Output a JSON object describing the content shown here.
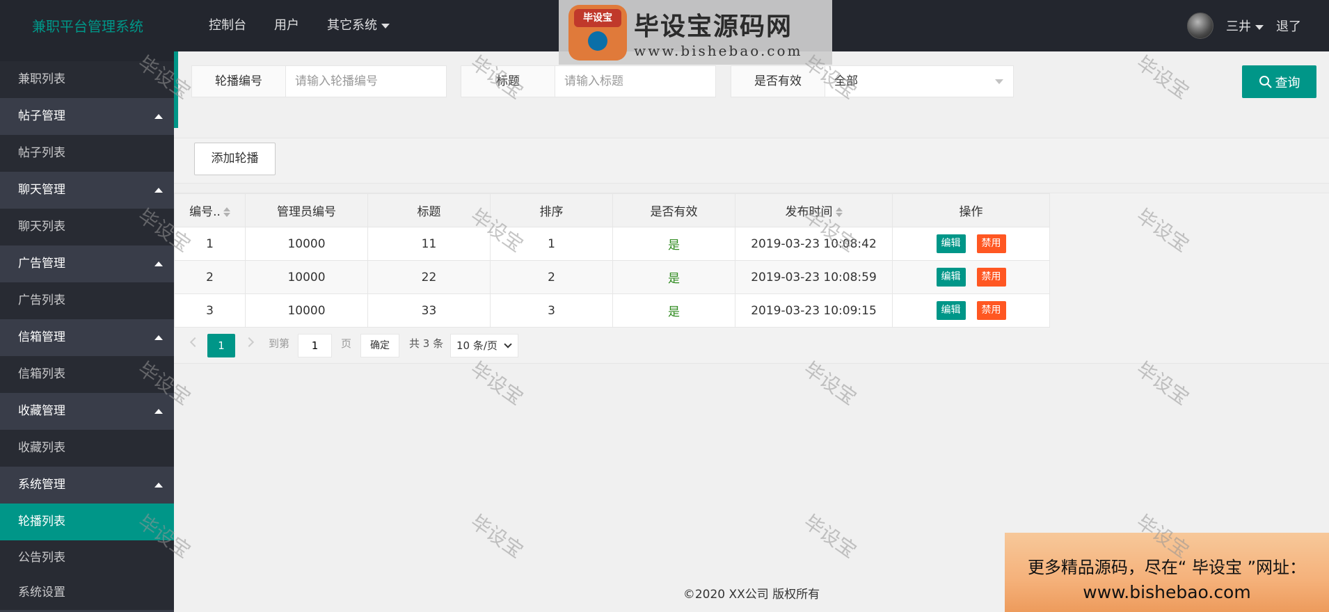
{
  "header": {
    "brand": "兼职平台管理系统",
    "nav": [
      "控制台",
      "用户",
      "其它系统"
    ],
    "user_name": "三井",
    "logout": "退了"
  },
  "logo_watermark": {
    "badge": "毕设宝",
    "title": "毕设宝源码网",
    "url": "www.bishebao.com"
  },
  "sidebar": [
    {
      "label": "兼职列表",
      "type": "child"
    },
    {
      "label": "帖子管理",
      "type": "parent"
    },
    {
      "label": "帖子列表",
      "type": "child"
    },
    {
      "label": "聊天管理",
      "type": "parent"
    },
    {
      "label": "聊天列表",
      "type": "child"
    },
    {
      "label": "广告管理",
      "type": "parent"
    },
    {
      "label": "广告列表",
      "type": "child"
    },
    {
      "label": "信箱管理",
      "type": "parent"
    },
    {
      "label": "信箱列表",
      "type": "child"
    },
    {
      "label": "收藏管理",
      "type": "parent"
    },
    {
      "label": "收藏列表",
      "type": "child"
    },
    {
      "label": "系统管理",
      "type": "parent"
    },
    {
      "label": "轮播列表",
      "type": "active"
    },
    {
      "label": "公告列表",
      "type": "child"
    },
    {
      "label": "系统设置",
      "type": "child"
    }
  ],
  "search": {
    "id_label": "轮播编号",
    "id_placeholder": "请输入轮播编号",
    "title_label": "标题",
    "title_placeholder": "请输入标题",
    "valid_label": "是否有效",
    "valid_value": "全部",
    "query_button": "查询"
  },
  "toolbar": {
    "add_button": "添加轮播"
  },
  "table": {
    "headers": [
      "编号..",
      "管理员编号",
      "标题",
      "排序",
      "是否有效",
      "发布时间",
      "操作"
    ],
    "rows": [
      {
        "id": "1",
        "admin_id": "10000",
        "title": "11",
        "sort": "1",
        "valid": "是",
        "time": "2019-03-23 10:08:42"
      },
      {
        "id": "2",
        "admin_id": "10000",
        "title": "22",
        "sort": "2",
        "valid": "是",
        "time": "2019-03-23 10:08:59"
      },
      {
        "id": "3",
        "admin_id": "10000",
        "title": "33",
        "sort": "3",
        "valid": "是",
        "time": "2019-03-23 10:09:15"
      }
    ],
    "edit_label": "编辑",
    "ban_label": "禁用"
  },
  "pager": {
    "current": "1",
    "goto_prefix": "到第",
    "goto_value": "1",
    "goto_suffix": "页",
    "confirm": "确定",
    "total": "共 3 条",
    "page_size": "10 条/页"
  },
  "footer": "©2020 XX公司 版权所有",
  "watermark_text": "毕设宝",
  "promo": {
    "line1": "更多精品源码，尽在“ 毕设宝 ”网址：",
    "line2": "www.bishebao.com"
  },
  "colors": {
    "accent": "#009688",
    "danger": "#ff5722",
    "header_bg": "#23262e",
    "sidebar_bg": "#393d49"
  }
}
